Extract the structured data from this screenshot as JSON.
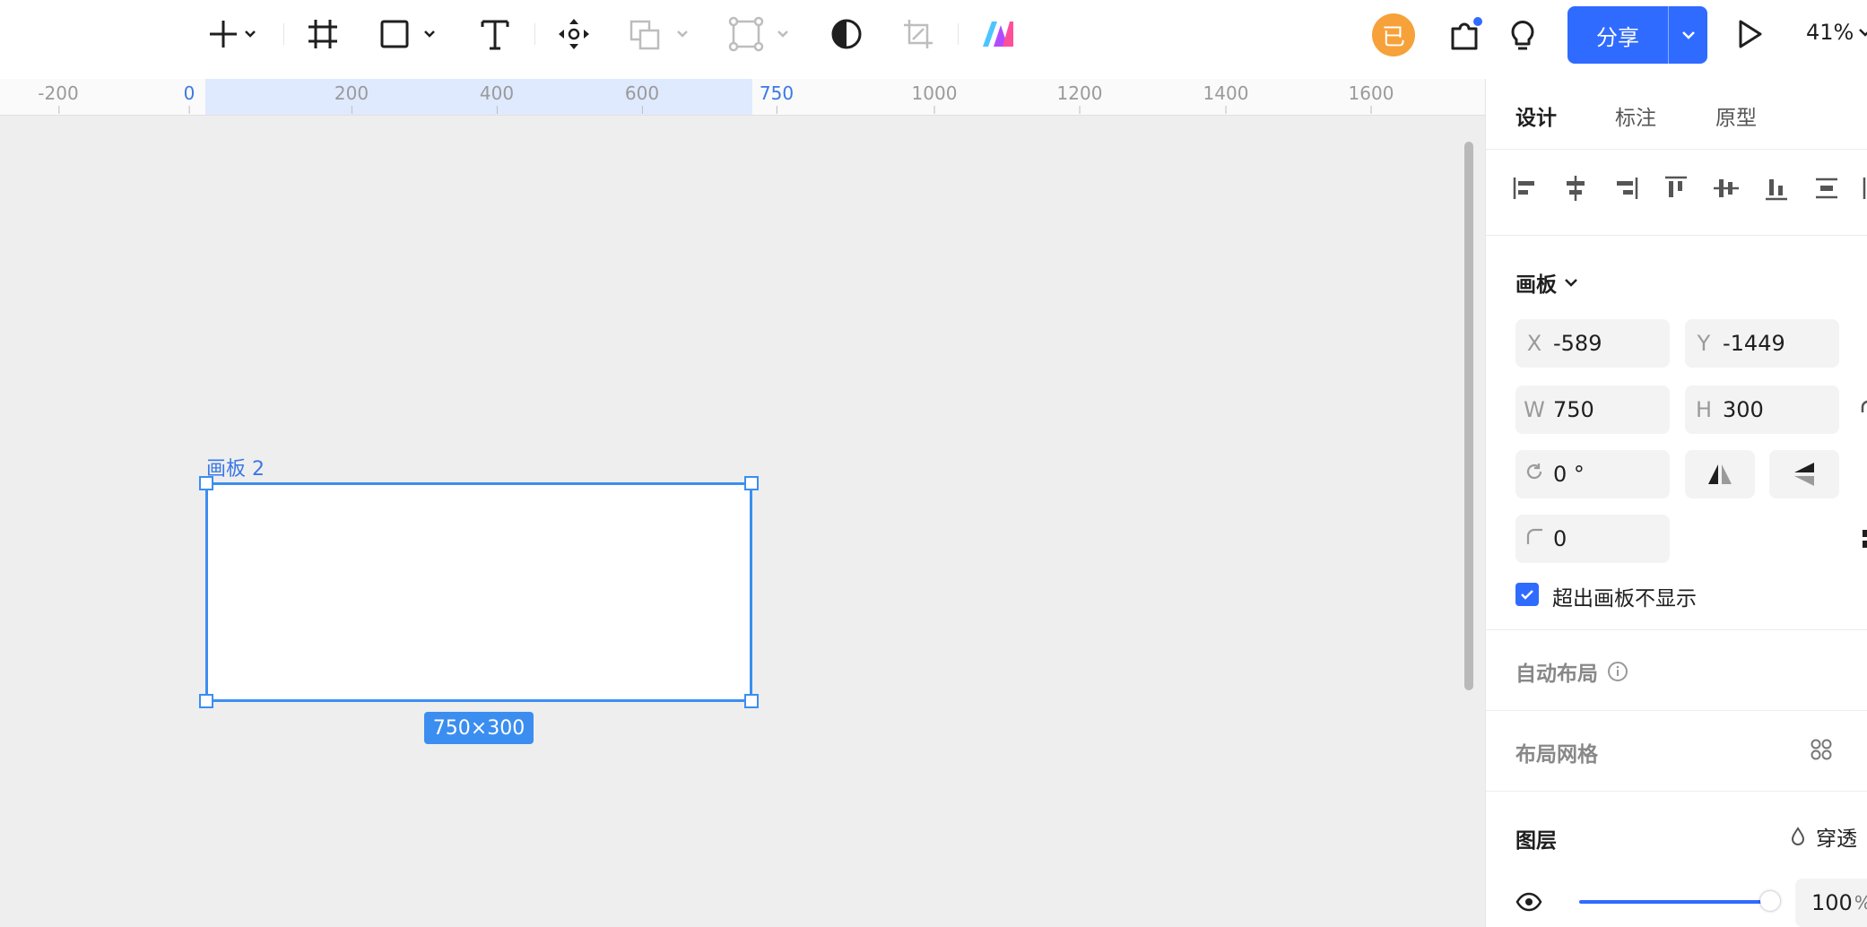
{
  "toolbar": {
    "tools": [
      "add",
      "frame",
      "rectangle",
      "text",
      "component",
      "boolean",
      "path-node",
      "mask",
      "crop",
      "ai-plugin"
    ],
    "avatar_text": "已",
    "share_label": "分享",
    "zoom": "41%",
    "notification_dot_color": "#2f6bff"
  },
  "ruler": {
    "ticks": [
      "-200",
      "0",
      "200",
      "400",
      "600",
      "750",
      "1000",
      "1200",
      "1400",
      "1600"
    ],
    "highlighted": [
      "0",
      "750"
    ]
  },
  "canvas": {
    "frame_name": "画板 2",
    "size_badge": "750×300",
    "accent": "#3b8ef0"
  },
  "panel": {
    "tabs": [
      "设计",
      "标注",
      "原型"
    ],
    "active_tab": "设计",
    "section_frame": "画板",
    "x_label": "X",
    "x_value": "-589",
    "y_label": "Y",
    "y_value": "-1449",
    "w_label": "W",
    "w_value": "750",
    "h_label": "H",
    "h_value": "300",
    "rotation": "0 °",
    "corner_radius": "0",
    "clip_content_label": "超出画板不显示",
    "clip_content_checked": true,
    "auto_layout_label": "自动布局",
    "layout_grid_label": "布局网格",
    "layer_label": "图层",
    "blend_mode": "穿透",
    "opacity": "100",
    "opacity_unit": "%"
  }
}
